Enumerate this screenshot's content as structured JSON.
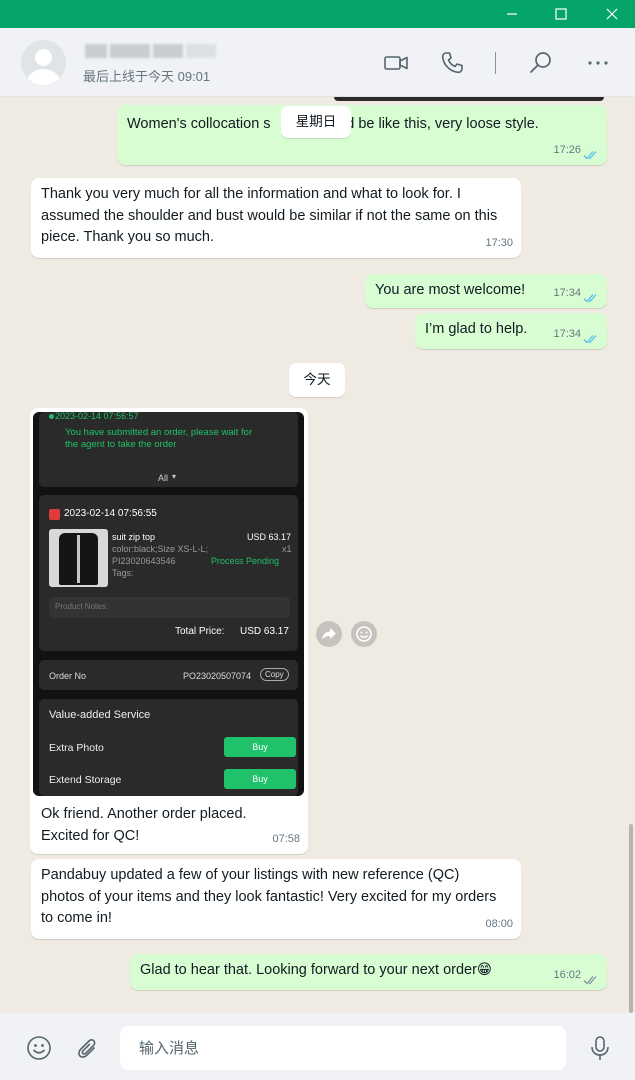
{
  "window": {
    "minimize_label": "—",
    "maximize_label": "☐",
    "close_label": "✕"
  },
  "header": {
    "last_seen": "最后上线于今天 09:01"
  },
  "messages": {
    "m1": {
      "text": "Women's collocation s",
      "text_tail": "ld be like this, very loose style.",
      "time": "17:26"
    },
    "date_weekday": "星期日",
    "m2": {
      "text": "Thank you very much for all the information and what to look for. I assumed the shoulder and bust would be similar if not the same on this piece. Thank you so much.",
      "time": "17:30"
    },
    "m3": {
      "text": "You are most welcome!",
      "time": "17:34"
    },
    "m4": {
      "text": "I’m glad to help.",
      "time": "17:34"
    },
    "date_today": "今天",
    "m5": {
      "caption": "Ok friend. Another order placed. Excited for QC!",
      "time": "07:58"
    },
    "m6": {
      "text": "Pandabuy updated a few of your listings with new reference (QC) photos of your items and they look fantastic! Very excited for my orders to come in!",
      "time": "08:00"
    },
    "m7": {
      "text": "Glad to hear that. Looking forward to your next order",
      "emoji": "😁",
      "time": "16:02"
    }
  },
  "order_screenshot": {
    "status_time": "2023-02-14 07:56:57",
    "status_text_1": "You have submitted an order, please wait for",
    "status_text_2": "the agent to take the order",
    "filter": "All",
    "order_time": "2023-02-14 07:56:55",
    "item_name": "suit zip top",
    "item_price": "USD 63.17",
    "item_variant": "color:black;Size XS-L-L;",
    "item_qty": "x1",
    "item_code": "PI23020643546",
    "item_status": "Process Pending",
    "item_tags": "Tags:",
    "notes_label": "Product Notes:",
    "total_label": "Total Price:",
    "total_value": "USD 63.17",
    "order_no_label": "Order No",
    "order_no_value": "PO23020507074",
    "copy_label": "Copy",
    "vas_title": "Value-added Service",
    "vas_1": "Extra Photo",
    "vas_2": "Extend Storage",
    "buy_label": "Buy"
  },
  "composer": {
    "placeholder": "输入消息"
  },
  "colors": {
    "titlebar": "#05a469",
    "outgoing_bubble": "#d9fdd3",
    "incoming_bubble": "#ffffff",
    "chat_bg": "#efeae2",
    "read_ticks": "#53bdeb"
  }
}
